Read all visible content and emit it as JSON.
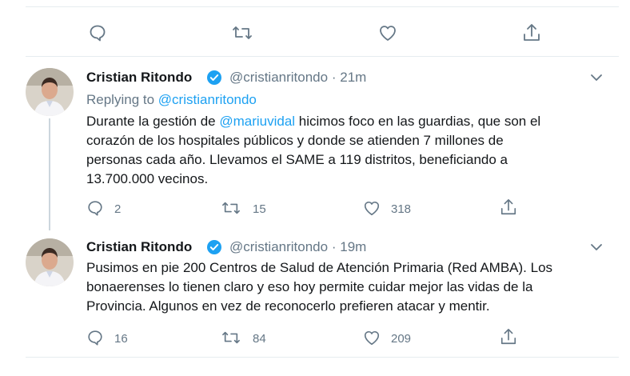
{
  "tweets": [
    {
      "author": "Cristian Ritondo",
      "handle": "@cristianritondo",
      "separator": "·",
      "time": "21m",
      "replying_prefix": "Replying to",
      "replying_to": "@cristianritondo",
      "text_line1_a": "Durante la gestión de ",
      "text_mention": "@mariuvidal",
      "text_line1_b": " hicimos foco en las guardias, que son el",
      "text_line2": "corazón de los hospitales públicos y donde se atienden 7 millones de",
      "text_line3": "personas cada año. Llevamos el SAME a 119 distritos, beneficiando a",
      "text_line4": "13.700.000 vecinos.",
      "replies": "2",
      "retweets": "15",
      "likes": "318"
    },
    {
      "author": "Cristian Ritondo",
      "handle": "@cristianritondo",
      "separator": "·",
      "time": "19m",
      "text_line1": "Pusimos en pie 200 Centros de Salud de Atención Primaria (Red AMBA). Los",
      "text_line2": "bonaerenses lo tienen claro y eso hoy permite cuidar mejor las vidas de la",
      "text_line3": "Provincia. Algunos en vez de reconocerlo prefieren atacar y mentir.",
      "replies": "16",
      "retweets": "84",
      "likes": "209"
    }
  ],
  "colors": {
    "accent": "#1da1f2",
    "muted": "#657786",
    "text": "#14171a",
    "divider": "#e6ecf0"
  },
  "icons": [
    "reply-icon",
    "retweet-icon",
    "like-icon",
    "share-icon",
    "verified-badge-icon",
    "chevron-down-icon"
  ]
}
